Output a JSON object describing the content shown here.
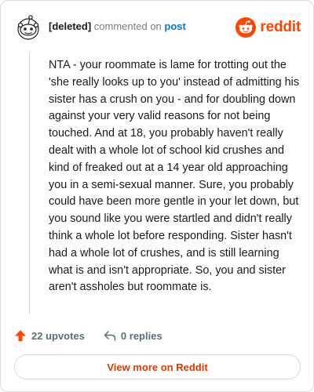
{
  "comment": {
    "author": "[deleted]",
    "action": "commented on",
    "target": "post",
    "body": "NTA - your roommate is lame for trotting out the 'she really looks up to you' instead of admitting his sister has a crush on you - and for doubling down against your very valid reasons for not being touched. And at 18, you probably haven't really dealt with a whole lot of school kid crushes and kind of freaked out at a 14 year old approaching you in a semi-sexual manner. Sure, you probably could have been more gentle in your let down, but you sound like you were startled and didn't really think a whole lot before responding. Sister hasn't had a whole lot of crushes, and is still learning what is and isn't appropriate. So, you and sister aren't assholes but roommate is.",
    "upvotes": "22 upvotes",
    "replies": "0 replies"
  },
  "brand": {
    "logo_text": "reddit",
    "color": "#ff4500"
  },
  "icons": {
    "avatar": "snoo-avatar-icon",
    "logo": "reddit-logo-icon",
    "upvote": "upvote-arrow-icon",
    "reply": "reply-arrow-icon"
  },
  "cta": {
    "label": "View more on Reddit"
  },
  "colors": {
    "link": "#0079d3",
    "upvote": "#ff4500",
    "muted": "#576f76",
    "cta_text": "#d93a00"
  }
}
